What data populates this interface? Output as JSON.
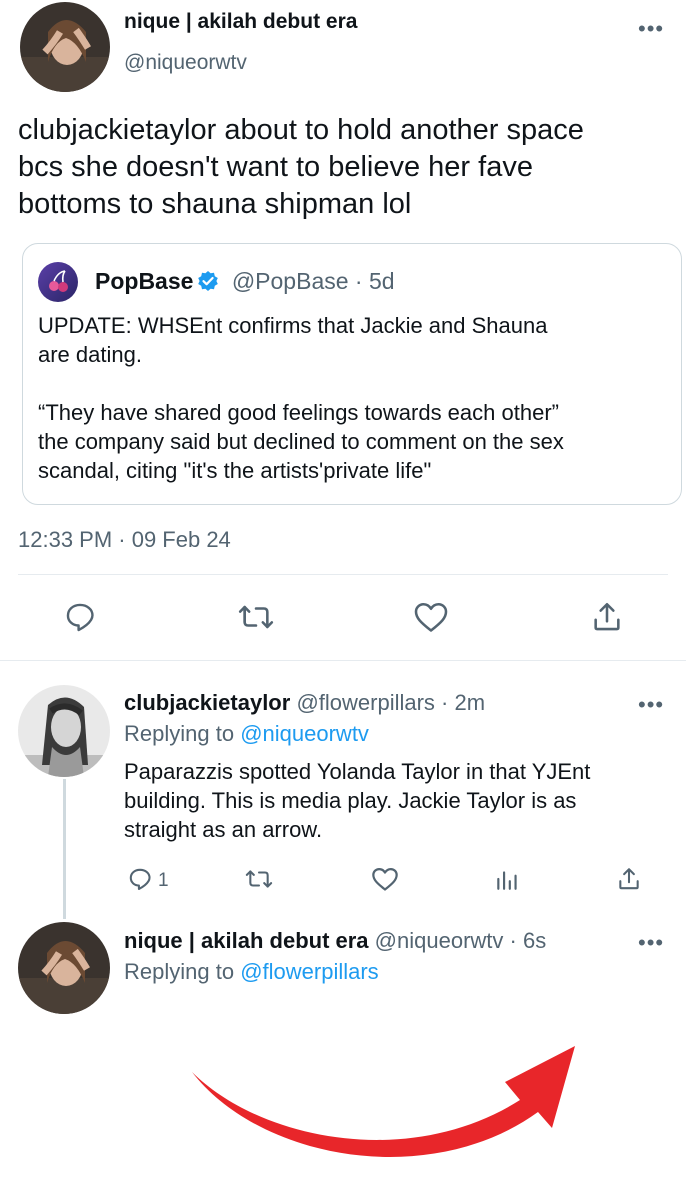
{
  "main_tweet": {
    "display_name": "nique | akilah debut era",
    "handle": "@niqueorwtv",
    "text_line1": "clubjackietaylor about to hold another space",
    "text_line2": "bcs she doesn't want to believe her fave",
    "text_line3": "bottoms to shauna shipman lol",
    "timestamp": "12:33 PM · 09 Feb 24"
  },
  "quoted_tweet": {
    "display_name": "PopBase",
    "handle": "@PopBase",
    "age": "· 5d",
    "line1": "UPDATE: WHSEnt confirms that Jackie and Shauna",
    "line2": "are dating.",
    "line3": "“They have shared good feelings towards each other”",
    "line4": "the company said but declined to comment on the sex",
    "line5": "scandal, citing \"it's the artists'private life\""
  },
  "reply1": {
    "display_name": "clubjackietaylor",
    "handle": "@flowerpillars",
    "age": "· 2m",
    "replying_prefix": "Replying to",
    "replying_to": "@niqueorwtv",
    "line1": "Paparazzis spotted Yolanda Taylor in that YJEnt",
    "line2": "building. This is media play. Jackie Taylor is as",
    "line3": "straight as an arrow.",
    "reply_count": "1"
  },
  "reply2": {
    "display_name": "nique | akilah debut era",
    "handle": "@niqueorwtv",
    "age": "· 6s",
    "replying_prefix": "Replying to",
    "replying_to": "@flowerpillars"
  },
  "icons": {
    "reply": "comment-icon",
    "retweet": "retweet-icon",
    "like": "heart-icon",
    "share": "share-icon",
    "analytics": "analytics-icon",
    "more": "more-icon",
    "verified": "verified-badge-icon",
    "annotation": "red-arrow"
  },
  "colors": {
    "link": "#1d9bf0",
    "muted": "#536471",
    "arrow": "#e8262a"
  }
}
